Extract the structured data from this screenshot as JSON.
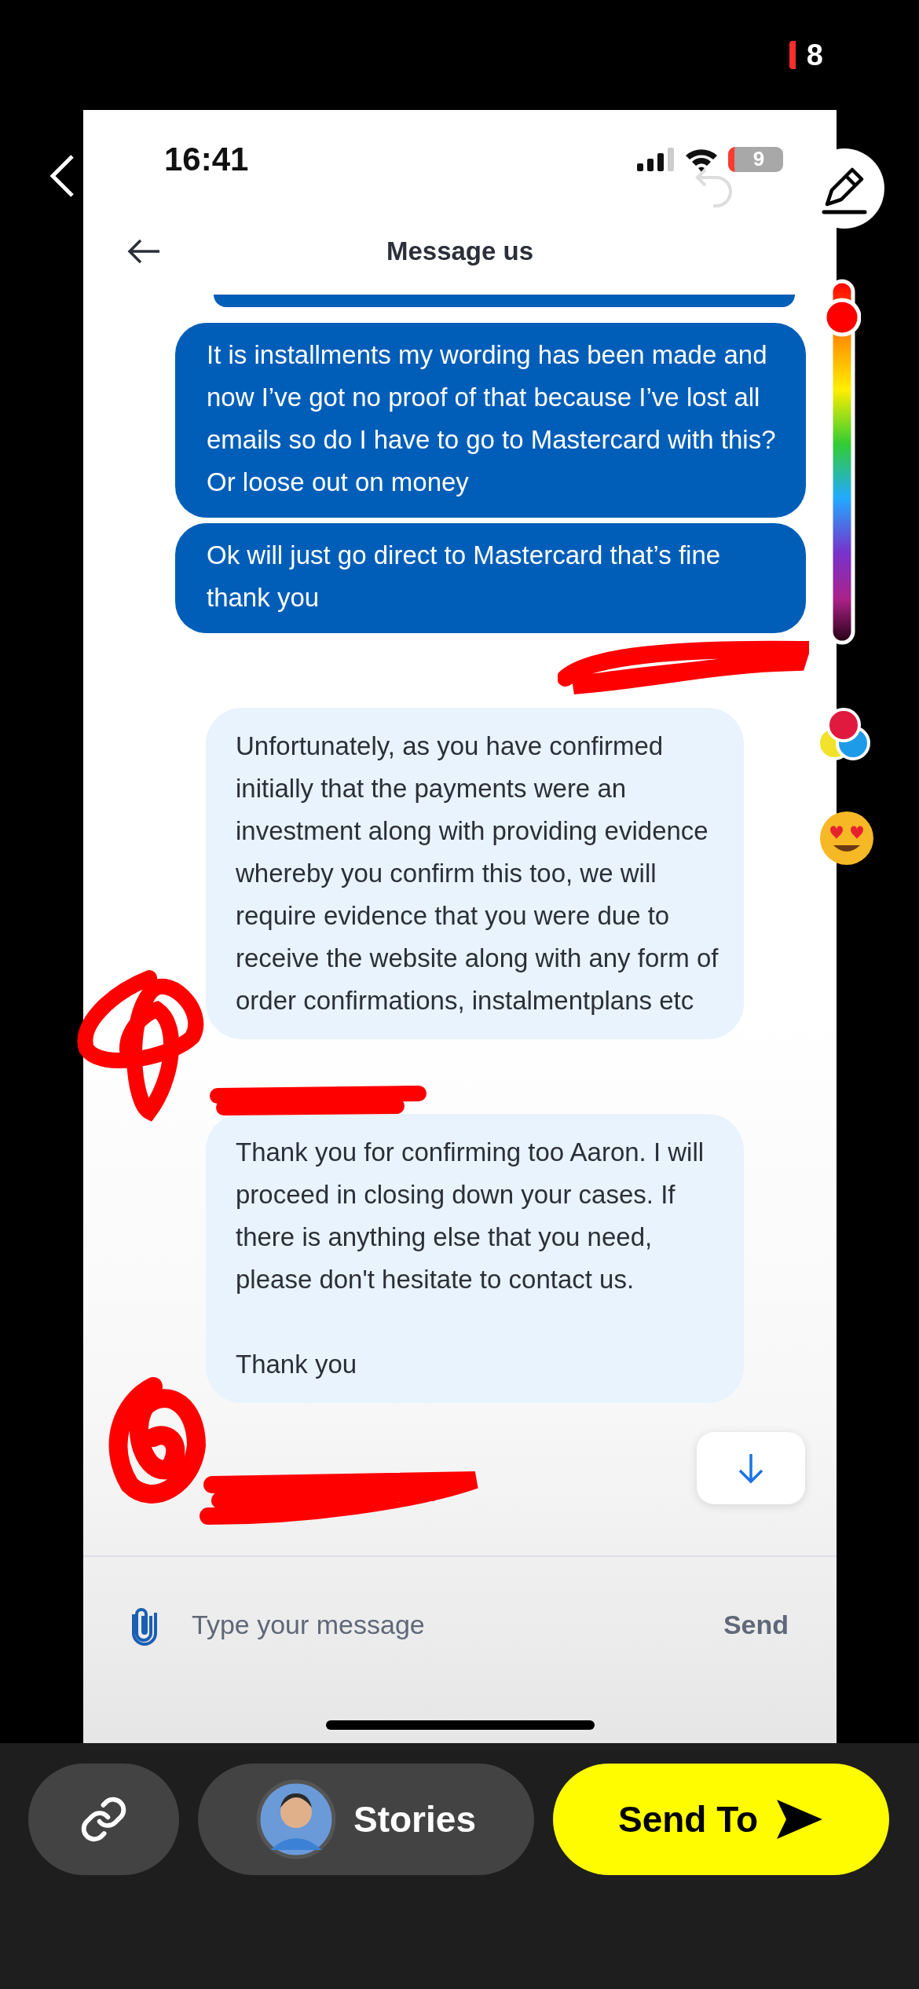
{
  "snap_toolbar": {
    "counter": "8"
  },
  "status_bar": {
    "time": "16:41",
    "battery": "9"
  },
  "header": {
    "title": "Message us"
  },
  "messages": [
    {
      "kind": "sent",
      "text": "It is installments my wording has been made and now I’ve got no proof of that because I’ve lost all emails so do I have to go to Mastercard with this? Or loose out on money"
    },
    {
      "kind": "sent",
      "text": "Ok will just go direct to Mastercard that’s fine thank you"
    },
    {
      "kind": "received",
      "text": "Unfortunately, as you have confirmed initially that the payments were an investment along with providing evidence whereby you confirm this too, we will require evidence that you were due to receive the website along with any form of order confirmations, instalmentplans etc"
    },
    {
      "kind": "received",
      "text": "Thank you for confirming too Aaron. I will proceed in closing down your cases. If there is anything else that you need, please don't hesitate to contact us.\n\nThank you"
    }
  ],
  "composer": {
    "placeholder": "Type your message",
    "send": "Send"
  },
  "share_bar": {
    "stories": "Stories",
    "send_to": "Send To"
  }
}
